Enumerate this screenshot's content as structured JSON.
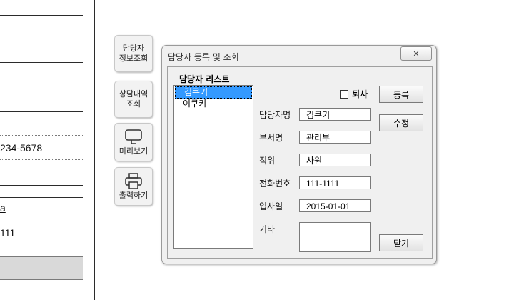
{
  "sheet": {
    "cells": [
      "234-5678",
      "111"
    ],
    "fragment_glyph": "a"
  },
  "side_buttons": {
    "staff_info": "담당자\n정보조회",
    "consult_history": "상담내역\n조회",
    "preview": "미리보기",
    "print": "출력하기"
  },
  "dialog": {
    "title": "담당자 등록 및 조회",
    "close_glyph": "✕",
    "list_caption": "담당자 리스트",
    "list_items": [
      "김쿠키",
      "이쿠키"
    ],
    "selected_index": 0,
    "retired_label": "퇴사",
    "retired_checked": false,
    "fields": {
      "name": {
        "label": "담당자명",
        "value": "김쿠키"
      },
      "dept": {
        "label": "부서명",
        "value": "관리부"
      },
      "position": {
        "label": "직위",
        "value": "사원"
      },
      "phone": {
        "label": "전화번호",
        "value": "111-1111"
      },
      "hire_date": {
        "label": "입사일",
        "value": "2015-01-01"
      },
      "note": {
        "label": "기타",
        "value": ""
      }
    },
    "buttons": {
      "register": "등록",
      "edit": "수정",
      "close": "닫기"
    }
  }
}
